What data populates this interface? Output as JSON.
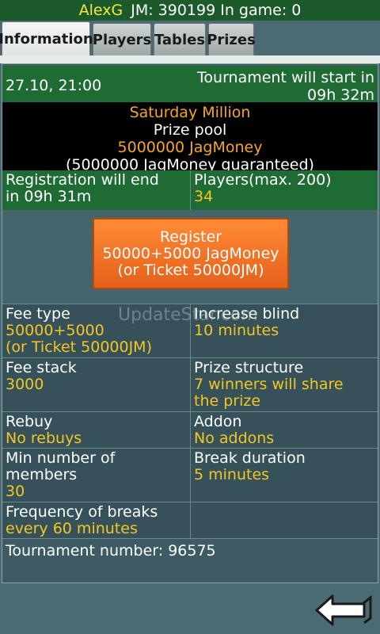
{
  "top": {
    "user": "AlexG",
    "stats": "JM: 390199 In game: 0"
  },
  "tabs": [
    "Information",
    "Players",
    "Tables",
    "Prizes"
  ],
  "header": {
    "datetime": "27.10, 21:00",
    "start_line1": "Tournament will start in",
    "start_line2": "09h 32m"
  },
  "prize": {
    "title": "Saturday Million",
    "label": "Prize pool",
    "amount": "5000000 JagMoney",
    "guaranteed": "(5000000 JagMoney guaranteed)"
  },
  "registration": {
    "end_line1": "Registration will end",
    "end_line2": "in 09h 31m",
    "players_label": "Players(max. 200)",
    "players_value": "34"
  },
  "register_button": {
    "line1": "Register",
    "line2": "50000+5000 JagMoney",
    "line3": "(or Ticket 50000JM)"
  },
  "watermark": "UpdateStar.com",
  "details": {
    "fee_type_label": "Fee type",
    "fee_type_value1": "50000+5000",
    "fee_type_value2": "(or Ticket 50000JM)",
    "increase_blind_label": "Increase blind",
    "increase_blind_value": "10 minutes",
    "fee_stack_label": "Fee stack",
    "fee_stack_value": "3000",
    "prize_structure_label": "Prize structure",
    "prize_structure_value1": "7 winners will share",
    "prize_structure_value2": "the prize",
    "rebuy_label": "Rebuy",
    "rebuy_value": "No rebuys",
    "addon_label": "Addon",
    "addon_value": "No addons",
    "min_members_label1": "Min number of",
    "min_members_label2": "members",
    "min_members_value": "30",
    "break_duration_label": "Break duration",
    "break_duration_value": "5 minutes",
    "freq_breaks_label": "Frequency of breaks",
    "freq_breaks_value": "every 60 minutes",
    "tournament_number": "Tournament number: 96575"
  }
}
